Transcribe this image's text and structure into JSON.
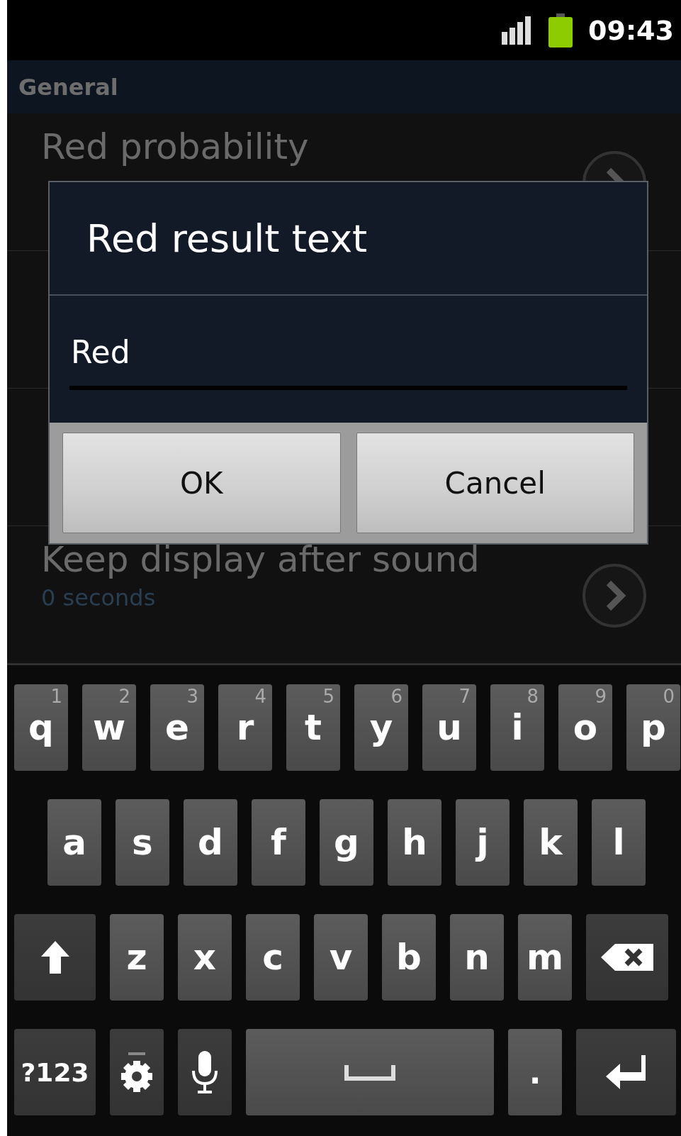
{
  "status_bar": {
    "time": "09:43"
  },
  "header": {
    "title": "General"
  },
  "settings": [
    {
      "kind": "item",
      "title": "Red probability"
    },
    {
      "kind": "covered"
    },
    {
      "kind": "covered"
    },
    {
      "kind": "item",
      "title": "Keep display after sound",
      "summary": "0 seconds"
    }
  ],
  "dialog": {
    "title": "Red result text",
    "value": "Red",
    "buttons": [
      "OK",
      "Cancel"
    ]
  },
  "keyboard": {
    "number_row": [
      {
        "kind": "letter",
        "label": "q",
        "hint": "1"
      },
      {
        "kind": "letter",
        "label": "w",
        "hint": "2"
      },
      {
        "kind": "letter",
        "label": "e",
        "hint": "3"
      },
      {
        "kind": "letter",
        "label": "r",
        "hint": "4"
      },
      {
        "kind": "letter",
        "label": "t",
        "hint": "5"
      },
      {
        "kind": "letter",
        "label": "y",
        "hint": "6"
      },
      {
        "kind": "letter",
        "label": "u",
        "hint": "7"
      },
      {
        "kind": "letter",
        "label": "i",
        "hint": "8"
      },
      {
        "kind": "letter",
        "label": "o",
        "hint": "9"
      },
      {
        "kind": "letter",
        "label": "p",
        "hint": "0"
      }
    ],
    "home_row": [
      {
        "kind": "letter",
        "label": "a"
      },
      {
        "kind": "letter",
        "label": "s"
      },
      {
        "kind": "letter",
        "label": "d"
      },
      {
        "kind": "letter",
        "label": "f"
      },
      {
        "kind": "letter",
        "label": "g"
      },
      {
        "kind": "letter",
        "label": "h"
      },
      {
        "kind": "letter",
        "label": "j"
      },
      {
        "kind": "letter",
        "label": "k"
      },
      {
        "kind": "letter",
        "label": "l"
      }
    ],
    "lower_row": [
      {
        "kind": "shift"
      },
      {
        "kind": "letter",
        "label": "z"
      },
      {
        "kind": "letter",
        "label": "x"
      },
      {
        "kind": "letter",
        "label": "c"
      },
      {
        "kind": "letter",
        "label": "v"
      },
      {
        "kind": "letter",
        "label": "b"
      },
      {
        "kind": "letter",
        "label": "n"
      },
      {
        "kind": "letter",
        "label": "m"
      },
      {
        "kind": "backspace"
      }
    ],
    "bottom_row": [
      {
        "kind": "symbols",
        "label": "?123"
      },
      {
        "kind": "settings"
      },
      {
        "kind": "mic"
      },
      {
        "kind": "space"
      },
      {
        "kind": "period",
        "label": "."
      },
      {
        "kind": "enter"
      }
    ]
  }
}
